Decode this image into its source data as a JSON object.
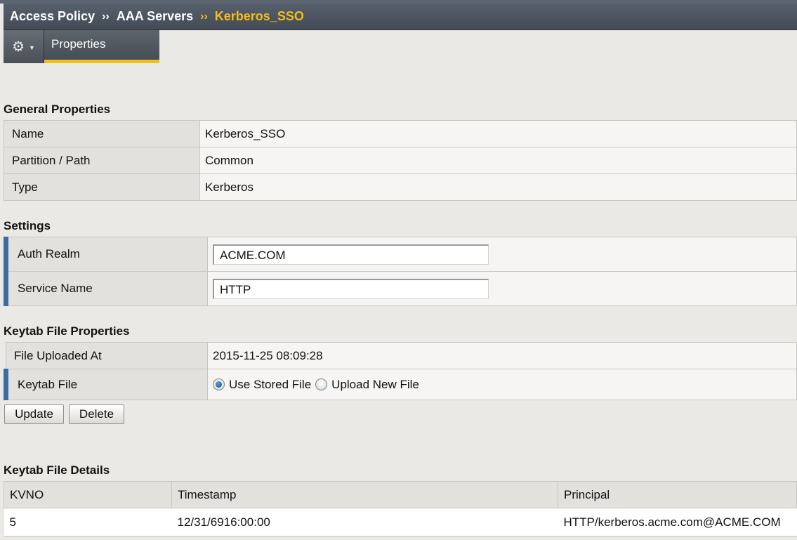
{
  "breadcrumb": {
    "items": [
      "Access Policy",
      "AAA Servers"
    ],
    "separator": "››",
    "current": "Kerberos_SSO"
  },
  "tabs": {
    "gear_icon": "gear-icon",
    "properties_label": "Properties"
  },
  "general": {
    "title": "General Properties",
    "rows": [
      {
        "label": "Name",
        "value": "Kerberos_SSO"
      },
      {
        "label": "Partition / Path",
        "value": "Common"
      },
      {
        "label": "Type",
        "value": "Kerberos"
      }
    ]
  },
  "settings": {
    "title": "Settings",
    "auth_realm_label": "Auth Realm",
    "auth_realm_value": "ACME.COM",
    "service_name_label": "Service Name",
    "service_name_value": "HTTP"
  },
  "keytab": {
    "title": "Keytab File Properties",
    "uploaded_label": "File Uploaded At",
    "uploaded_value": "2015-11-25 08:09:28",
    "file_label": "Keytab File",
    "option_stored": "Use Stored File",
    "option_upload": "Upload New File",
    "selected": "Use Stored File"
  },
  "actions": {
    "update_label": "Update",
    "delete_label": "Delete"
  },
  "details": {
    "title": "Keytab File Details",
    "columns": [
      "KVNO",
      "Timestamp",
      "Principal"
    ],
    "rows": [
      [
        "5",
        "12/31/6916:00:00",
        "HTTP/kerberos.acme.com@ACME.COM"
      ]
    ]
  },
  "colors": {
    "accent": "#f4be1a",
    "header": "#4b535c",
    "required_marker": "#3a6ea0",
    "background": "#ebe9e6"
  }
}
